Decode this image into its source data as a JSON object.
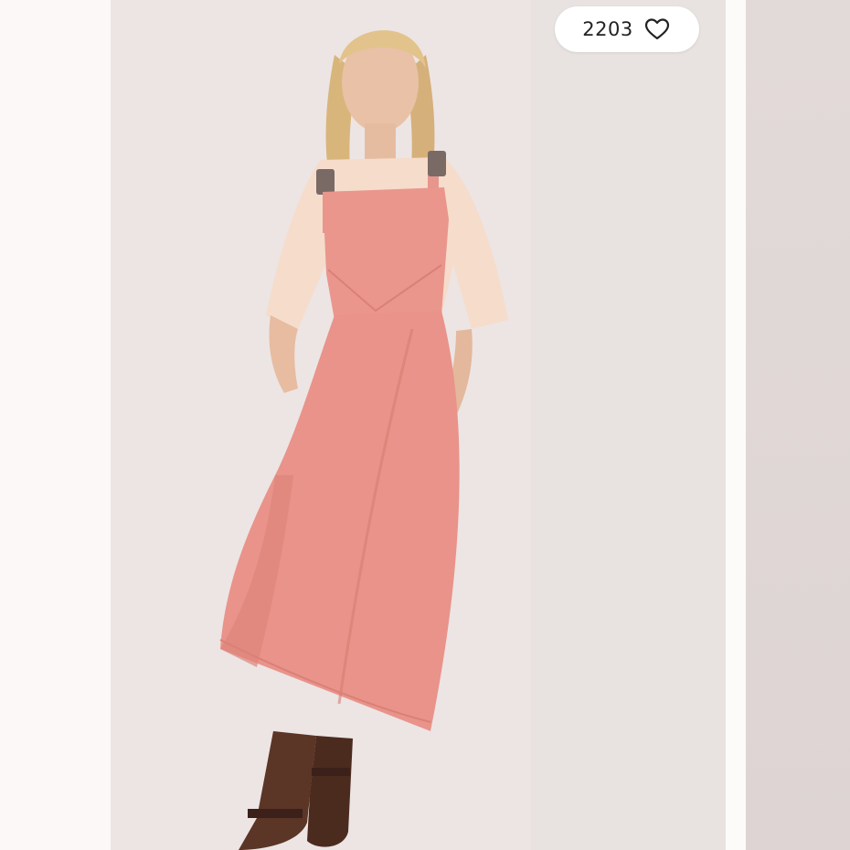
{
  "listing": {
    "like_count": "2203",
    "like_icon": "heart-outline-icon"
  },
  "colors": {
    "dress": "#e9958c",
    "backdrop": "#ebe4e3",
    "pill_bg": "#ffffff",
    "text": "#222222"
  }
}
